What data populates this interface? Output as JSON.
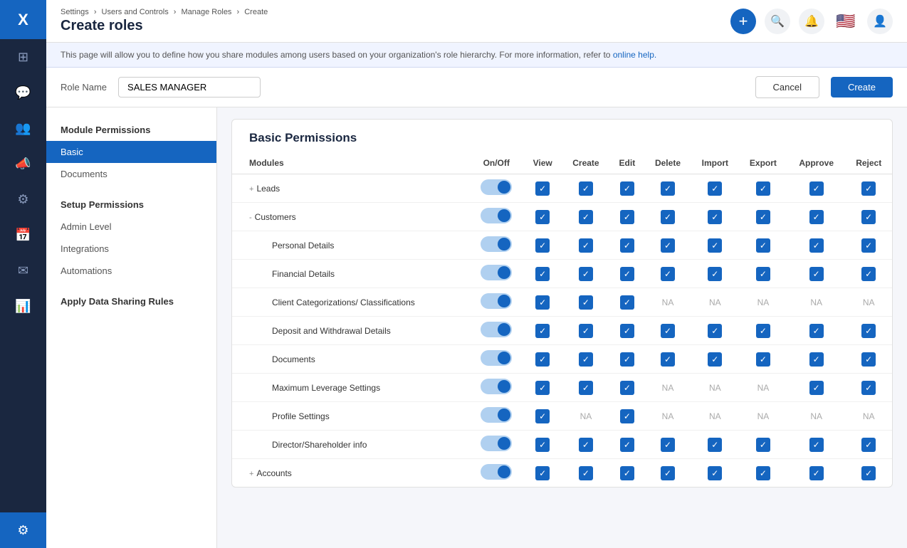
{
  "sidebar": {
    "logo": "X",
    "icons": [
      {
        "name": "dashboard-icon",
        "symbol": "⊞",
        "active": false
      },
      {
        "name": "chat-icon",
        "symbol": "💬",
        "active": false
      },
      {
        "name": "users-icon",
        "symbol": "👥",
        "active": false
      },
      {
        "name": "megaphone-icon",
        "symbol": "📣",
        "active": false
      },
      {
        "name": "support-icon",
        "symbol": "⚙",
        "active": false
      },
      {
        "name": "calendar-icon",
        "symbol": "📅",
        "active": false
      },
      {
        "name": "mail-icon",
        "symbol": "✉",
        "active": false
      },
      {
        "name": "chart-icon",
        "symbol": "📊",
        "active": false
      },
      {
        "name": "settings-icon",
        "symbol": "⚙",
        "active": true
      }
    ]
  },
  "topbar": {
    "breadcrumbs": [
      "Settings",
      "Users and Controls",
      "Manage Roles",
      "Create"
    ],
    "title": "Create roles",
    "add_btn": "+",
    "search_icon": "🔍",
    "bell_icon": "🔔",
    "flag_icon": "🇺🇸",
    "user_icon": "👤"
  },
  "info_bar": {
    "text": "This page will allow you to define how you share modules among users based on your organization's role hierarchy. For more information, refer to",
    "link_text": "online help.",
    "link_href": "#"
  },
  "role_name": {
    "label": "Role Name",
    "value": "SALES MANAGER",
    "cancel_label": "Cancel",
    "create_label": "Create"
  },
  "left_nav": {
    "sections": [
      {
        "title": "Module Permissions",
        "items": [
          {
            "label": "Basic",
            "active": true
          },
          {
            "label": "Documents",
            "active": false
          }
        ]
      },
      {
        "title": "Setup Permissions",
        "items": [
          {
            "label": "Admin Level",
            "active": false
          },
          {
            "label": "Integrations",
            "active": false
          },
          {
            "label": "Automations",
            "active": false
          }
        ]
      },
      {
        "title": "Apply Data Sharing Rules",
        "items": []
      }
    ]
  },
  "permissions": {
    "title": "Basic Permissions",
    "columns": [
      "Modules",
      "On/Off",
      "View",
      "Create",
      "Edit",
      "Delete",
      "Import",
      "Export",
      "Approve",
      "Reject"
    ],
    "rows": [
      {
        "id": "leads",
        "label": "Leads",
        "indent": false,
        "expandable": true,
        "expand_state": "+",
        "toggle": "on",
        "view": "check",
        "create": "check",
        "edit": "check",
        "delete": "check",
        "import": "check",
        "export": "check",
        "approve": "check",
        "reject": "check"
      },
      {
        "id": "customers",
        "label": "Customers",
        "indent": false,
        "expandable": true,
        "expand_state": "-",
        "toggle": "on",
        "view": "check",
        "create": "check",
        "edit": "check",
        "delete": "check",
        "import": "check",
        "export": "check",
        "approve": "check",
        "reject": "check"
      },
      {
        "id": "personal-details",
        "label": "Personal Details",
        "indent": true,
        "expandable": false,
        "expand_state": "",
        "toggle": "on",
        "view": "check",
        "create": "check",
        "edit": "check",
        "delete": "check",
        "import": "check",
        "export": "check",
        "approve": "check",
        "reject": "check"
      },
      {
        "id": "financial-details",
        "label": "Financial Details",
        "indent": true,
        "expandable": false,
        "expand_state": "",
        "toggle": "on",
        "view": "check",
        "create": "check",
        "edit": "check",
        "delete": "check",
        "import": "check",
        "export": "check",
        "approve": "check",
        "reject": "check"
      },
      {
        "id": "client-categorizations",
        "label": "Client Categorizations/ Classifications",
        "indent": true,
        "expandable": false,
        "expand_state": "",
        "toggle": "on",
        "view": "check",
        "create": "check",
        "edit": "check",
        "delete": "NA",
        "import": "NA",
        "export": "NA",
        "approve": "NA",
        "reject": "NA"
      },
      {
        "id": "deposit-withdrawal",
        "label": "Deposit and Withdrawal Details",
        "indent": true,
        "expandable": false,
        "expand_state": "",
        "toggle": "on",
        "view": "check",
        "create": "check",
        "edit": "check",
        "delete": "check",
        "import": "check",
        "export": "check",
        "approve": "check",
        "reject": "check"
      },
      {
        "id": "documents",
        "label": "Documents",
        "indent": true,
        "expandable": false,
        "expand_state": "",
        "toggle": "on",
        "view": "check",
        "create": "check",
        "edit": "check",
        "delete": "check",
        "import": "check",
        "export": "check",
        "approve": "check",
        "reject": "check"
      },
      {
        "id": "max-leverage",
        "label": "Maximum Leverage Settings",
        "indent": true,
        "expandable": false,
        "expand_state": "",
        "toggle": "on",
        "view": "check",
        "create": "check",
        "edit": "check",
        "delete": "NA",
        "import": "NA",
        "export": "NA",
        "approve": "check",
        "reject": "check"
      },
      {
        "id": "profile-settings",
        "label": "Profile Settings",
        "indent": true,
        "expandable": false,
        "expand_state": "",
        "toggle": "on",
        "view": "check",
        "create": "NA",
        "edit": "check",
        "delete": "NA",
        "import": "NA",
        "export": "NA",
        "approve": "NA",
        "reject": "NA"
      },
      {
        "id": "director-shareholder",
        "label": "Director/Shareholder info",
        "indent": true,
        "expandable": false,
        "expand_state": "",
        "toggle": "on",
        "view": "check",
        "create": "check",
        "edit": "check",
        "delete": "check",
        "import": "check",
        "export": "check",
        "approve": "check",
        "reject": "check"
      },
      {
        "id": "accounts",
        "label": "Accounts",
        "indent": false,
        "expandable": true,
        "expand_state": "+",
        "toggle": "on",
        "view": "check",
        "create": "check",
        "edit": "check",
        "delete": "check",
        "import": "check",
        "export": "check",
        "approve": "check",
        "reject": "check"
      }
    ]
  }
}
